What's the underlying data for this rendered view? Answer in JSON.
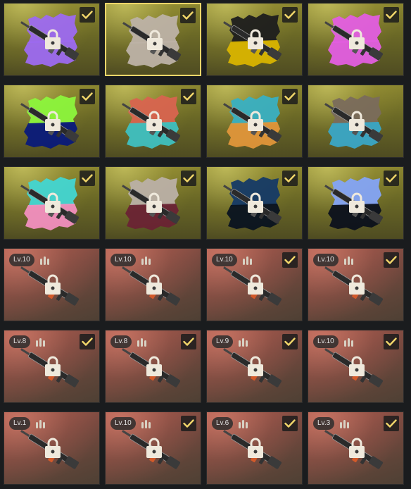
{
  "cards": [
    {
      "bg": "y",
      "paint": [
        "#9d6af0",
        "#9d6af0"
      ],
      "check": true,
      "selected": false,
      "level": ""
    },
    {
      "bg": "y",
      "paint": [
        "#bdb2a6",
        "#bdb2a6"
      ],
      "check": true,
      "selected": true,
      "level": ""
    },
    {
      "bg": "y",
      "paint": [
        "#1e1e1e",
        "#d9b400"
      ],
      "check": true,
      "selected": false,
      "level": ""
    },
    {
      "bg": "y",
      "paint": [
        "#e35ee0",
        "#e35ee0"
      ],
      "check": true,
      "selected": false,
      "level": ""
    },
    {
      "bg": "y",
      "paint": [
        "#8cf53c",
        "#0a1a7a"
      ],
      "check": true,
      "selected": false,
      "level": ""
    },
    {
      "bg": "y",
      "paint": [
        "#d8644f",
        "#3fc0c0"
      ],
      "check": true,
      "selected": false,
      "level": ""
    },
    {
      "bg": "y",
      "paint": [
        "#39b0c2",
        "#e0963a"
      ],
      "check": true,
      "selected": false,
      "level": ""
    },
    {
      "bg": "y",
      "paint": [
        "#7a6c5c",
        "#3aa6c6"
      ],
      "check": false,
      "selected": false,
      "level": ""
    },
    {
      "bg": "y",
      "paint": [
        "#42d6d2",
        "#f28fbf"
      ],
      "check": true,
      "selected": false,
      "level": ""
    },
    {
      "bg": "y",
      "paint": [
        "#bbb0a6",
        "#6a2334"
      ],
      "check": true,
      "selected": false,
      "level": ""
    },
    {
      "bg": "y",
      "paint": [
        "#153a66",
        "#0a1320"
      ],
      "check": true,
      "selected": false,
      "level": ""
    },
    {
      "bg": "y",
      "paint": [
        "#84a4f6",
        "#0c111c"
      ],
      "check": true,
      "selected": false,
      "level": ""
    },
    {
      "bg": "r",
      "paint": [],
      "check": false,
      "selected": false,
      "level": "Lv.10"
    },
    {
      "bg": "r",
      "paint": [],
      "check": false,
      "selected": false,
      "level": "Lv.10"
    },
    {
      "bg": "r",
      "paint": [],
      "check": true,
      "selected": false,
      "level": "Lv.10"
    },
    {
      "bg": "r",
      "paint": [],
      "check": true,
      "selected": false,
      "level": "Lv.10"
    },
    {
      "bg": "r",
      "paint": [],
      "check": true,
      "selected": false,
      "level": "Lv.8"
    },
    {
      "bg": "r",
      "paint": [],
      "check": true,
      "selected": false,
      "level": "Lv.8"
    },
    {
      "bg": "r",
      "paint": [],
      "check": true,
      "selected": false,
      "level": "Lv.9"
    },
    {
      "bg": "r",
      "paint": [],
      "check": true,
      "selected": false,
      "level": "Lv.10"
    },
    {
      "bg": "r",
      "paint": [],
      "check": false,
      "selected": false,
      "level": "Lv.1"
    },
    {
      "bg": "r",
      "paint": [],
      "check": true,
      "selected": false,
      "level": "Lv.10"
    },
    {
      "bg": "r",
      "paint": [],
      "check": true,
      "selected": false,
      "level": "Lv.6"
    },
    {
      "bg": "r",
      "paint": [],
      "check": true,
      "selected": false,
      "level": "Lv.3"
    }
  ],
  "icons": {
    "check": "check-icon",
    "lock": "lock-icon",
    "ammo": "ammo-icon",
    "weapon": "weapon-icon"
  },
  "colors": {
    "check": "#f1d66a",
    "lock": "#efe9dc",
    "selected_border": "#f1d66a"
  }
}
